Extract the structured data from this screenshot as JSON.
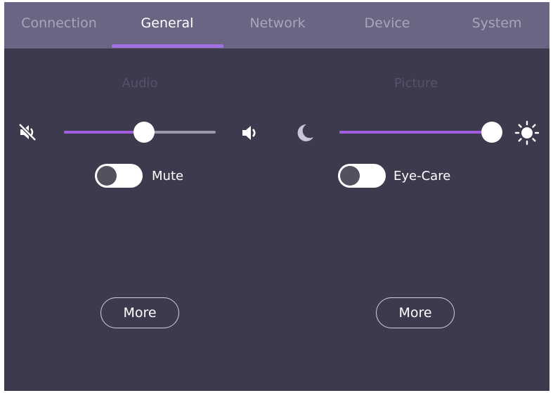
{
  "tabs": [
    {
      "label": "Connection",
      "active": false
    },
    {
      "label": "General",
      "active": true
    },
    {
      "label": "Network",
      "active": false
    },
    {
      "label": "Device",
      "active": false
    },
    {
      "label": "System",
      "active": false
    }
  ],
  "audio": {
    "title": "Audio",
    "volume_percent": 53,
    "min_icon": "volume-mute-icon",
    "max_icon": "volume-up-icon",
    "mute_label": "Mute",
    "mute_on": false,
    "more_label": "More"
  },
  "picture": {
    "title": "Picture",
    "brightness_percent": 100,
    "min_icon": "moon-icon",
    "max_icon": "sun-icon",
    "eyecare_label": "Eye-Care",
    "eyecare_on": false,
    "more_label": "More"
  },
  "colors": {
    "background": "#3d3a4d",
    "tabbar": "#6b6584",
    "accent": "#a15ee2",
    "tab_active": "#ffffff",
    "tab_inactive": "#a9a5b9"
  }
}
